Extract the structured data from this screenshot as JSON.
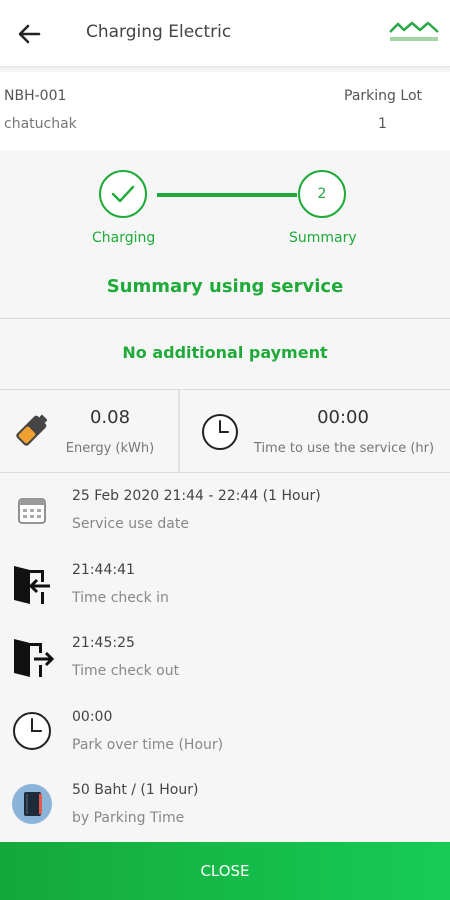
{
  "header": {
    "title": "Charging Electric"
  },
  "info": {
    "station_id": "NBH-001",
    "location_label": "Parking Lot",
    "area": "chatuchak",
    "lot_number": "1"
  },
  "stepper": {
    "step1_label": "Charging",
    "step2_number": "2",
    "step2_label": "Summary"
  },
  "summary": {
    "title": "Summary using service",
    "payment_status": "No additional payment"
  },
  "stats": {
    "energy_value": "0.08",
    "energy_label": "Energy (kWh)",
    "time_value": "00:00",
    "time_label": "Time to use the service (hr)"
  },
  "details": [
    {
      "value": "25 Feb 2020 21:44 - 22:44 (1 Hour)",
      "label": "Service use date",
      "icon": "calendar-icon"
    },
    {
      "value": "21:44:41",
      "label": "Time check in",
      "icon": "door-enter-icon"
    },
    {
      "value": "21:45:25",
      "label": "Time check out",
      "icon": "door-exit-icon"
    },
    {
      "value": "00:00",
      "label": "Park over time (Hour)",
      "icon": "clock-icon"
    },
    {
      "value": "50 Baht / (1 Hour)",
      "label": "by Parking Time",
      "icon": "notebook-icon"
    }
  ],
  "footer": {
    "close_label": "CLOSE"
  },
  "colors": {
    "accent": "#1faa3a",
    "button_start": "#15a83a",
    "button_end": "#17cb56"
  }
}
